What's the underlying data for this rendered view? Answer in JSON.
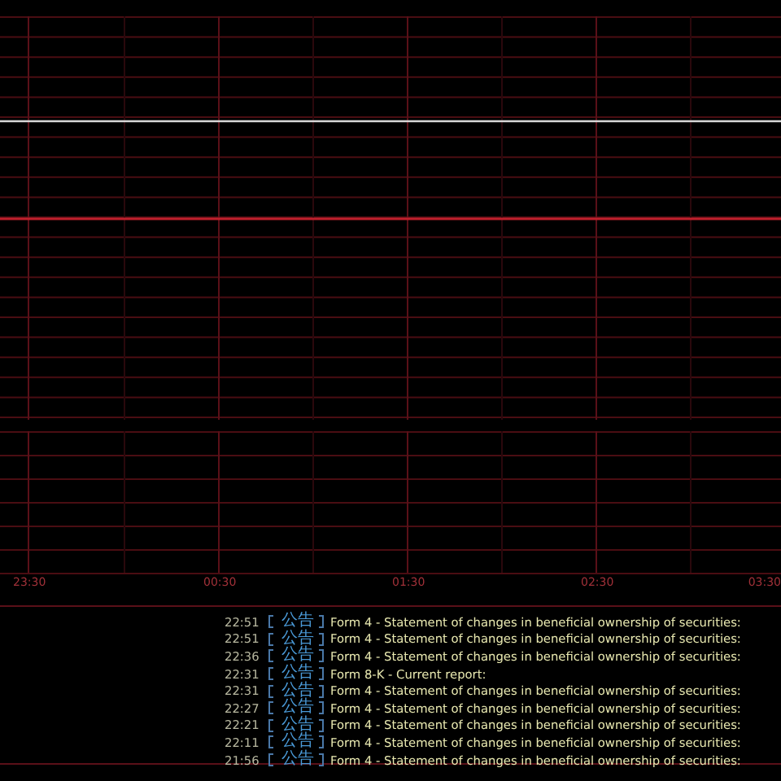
{
  "chart": {
    "time_labels": [
      "23:30",
      "00:30",
      "01:30",
      "02:30",
      "03:30"
    ]
  },
  "news": [
    {
      "time": "22:51",
      "tag": "公告",
      "title": "Form 4 - Statement of changes in beneficial ownership of securities:"
    },
    {
      "time": "22:51",
      "tag": "公告",
      "title": "Form 4 - Statement of changes in beneficial ownership of securities:"
    },
    {
      "time": "22:36",
      "tag": "公告",
      "title": "Form 4 - Statement of changes in beneficial ownership of securities:"
    },
    {
      "time": "22:31",
      "tag": "公告",
      "title": "Form 8-K - Current report:"
    },
    {
      "time": "22:31",
      "tag": "公告",
      "title": "Form 4 - Statement of changes in beneficial ownership of securities:"
    },
    {
      "time": "22:27",
      "tag": "公告",
      "title": "Form 4 - Statement of changes in beneficial ownership of securities:"
    },
    {
      "time": "22:21",
      "tag": "公告",
      "title": "Form 4 - Statement of changes in beneficial ownership of securities:"
    },
    {
      "time": "22:11",
      "tag": "公告",
      "title": "Form 4 - Statement of changes in beneficial ownership of securities:"
    },
    {
      "time": "21:56",
      "tag": "公告",
      "title": "Form 4 - Statement of changes in beneficial ownership of securities:"
    }
  ]
}
